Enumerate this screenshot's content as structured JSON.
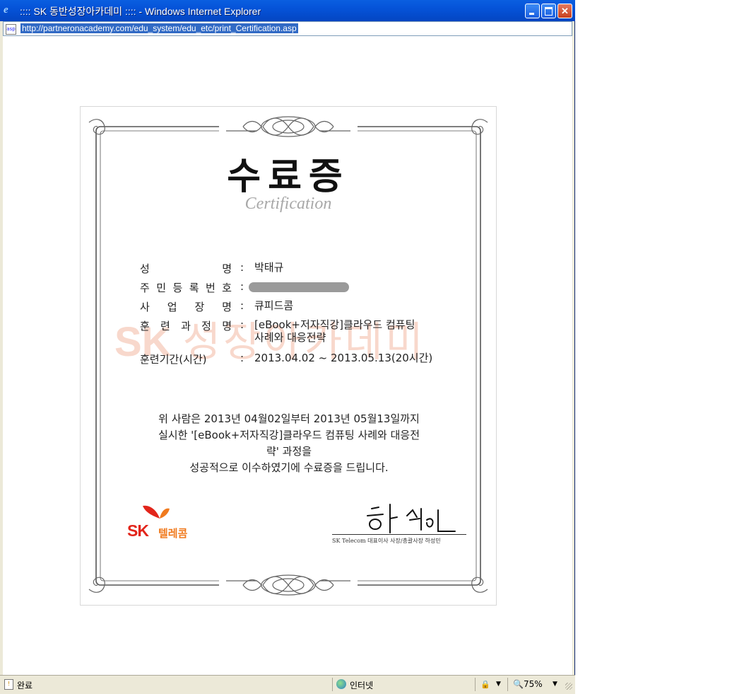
{
  "window": {
    "title": ":::: SK 동반성장아카데미 :::: - Windows Internet Explorer",
    "minimize_icon": "minimize-icon",
    "maximize_icon": "maximize-icon",
    "close_icon": "close-icon",
    "close_glyph": "✕"
  },
  "address_bar": {
    "url": "http://partneronacademy.com/edu_system/edu_etc/print_Certification.asp",
    "page_icon": "page-icon"
  },
  "certificate": {
    "title": "수료증",
    "subtitle": "Certification",
    "watermark_logo": "SK",
    "watermark_text": "성장아카데미",
    "fields": [
      {
        "label": "성명",
        "value": "박태규"
      },
      {
        "label": "주민등록번호",
        "value": ""
      },
      {
        "label": "사업장명",
        "value": "큐피드콤"
      },
      {
        "label": "훈련과정명",
        "value": "[eBook+저자직강]클라우드 컴퓨팅",
        "value2": "사례와 대응전략"
      },
      {
        "label": "훈련기간(시간)",
        "value": "2013.04.02 ~ 2013.05.13(20시간)"
      }
    ],
    "colon": ":",
    "body_lines": [
      "위 사람은 2013년 04월02일부터 2013년 05월13일까지",
      "실시한 '[eBook+저자직강]클라우드 컴퓨팅 사례와 대응전",
      "략' 과정을",
      "성공적으로 이수하였기에 수료증을 드립니다."
    ],
    "logo": {
      "sk": "SK",
      "name": "텔레콤"
    },
    "signature_caption": "SK Telecom 대표이사 사장/총괄사장   하성민"
  },
  "status_bar": {
    "status": "완료",
    "zone": "인터넷",
    "zoom": "75%",
    "dropdown_glyph": "▼",
    "lock_glyph": "🔒",
    "magnifier_glyph": "🔍"
  },
  "colors": {
    "titlebar": "#0553d8",
    "sk_red": "#e2251b",
    "sk_orange": "#f07a1e",
    "frame_gray": "#555555"
  }
}
